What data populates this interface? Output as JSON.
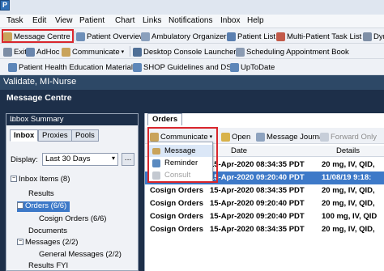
{
  "menubar": {
    "items": [
      "Task",
      "Edit",
      "View",
      "Patient",
      "Chart",
      "Links",
      "Notifications",
      "Inbox",
      "Help"
    ]
  },
  "toolbar1": {
    "items": [
      "Message Centre",
      "Patient Overview",
      "Ambulatory Organizer",
      "Patient List",
      "Multi-Patient Task List",
      "Dyr"
    ]
  },
  "toolbar2": {
    "items": [
      "Exit",
      "AdHoc",
      "Communicate",
      "Desktop Console Launcher",
      "Scheduling Appointment Book"
    ]
  },
  "toolbar3": {
    "items": [
      "Patient Health Education Materials",
      "SHOP Guidelines and DSTs",
      "UpToDate"
    ]
  },
  "validate_bar": {
    "title": "Validate, MI-Nurse"
  },
  "message_centre": {
    "title": "Message Centre"
  },
  "inbox_summary": {
    "title": "Inbox Summary",
    "tabs": [
      "Inbox",
      "Proxies",
      "Pools"
    ],
    "active_tab": "Inbox",
    "display_label": "Display:",
    "display_value": "Last 30 Days",
    "ellipsis": "...",
    "tree": [
      {
        "label": "Inbox Items (8)",
        "toggle": "−"
      },
      {
        "label": "Results",
        "toggle": ""
      },
      {
        "label": "Orders (6/6)",
        "toggle": "−",
        "selected": true
      },
      {
        "label": "Cosign Orders (6/6)",
        "toggle": ""
      },
      {
        "label": "Documents",
        "toggle": ""
      },
      {
        "label": "Messages (2/2)",
        "toggle": "−"
      },
      {
        "label": "General Messages (2/2)",
        "toggle": ""
      },
      {
        "label": "Results FYI",
        "toggle": ""
      }
    ]
  },
  "orders_panel": {
    "tab": "Orders",
    "toolbar": {
      "communicate": "Communicate",
      "open": "Open",
      "message_journal": "Message Journal",
      "forward_only": "Forward Only"
    },
    "columns": [
      "Date",
      "Details"
    ],
    "rows": [
      {
        "type": "",
        "date": "15-Apr-2020 08:34:35 PDT",
        "details": "20 mg, IV, QID,",
        "selected": false
      },
      {
        "type": "",
        "date": "15-Apr-2020 09:20:40 PDT",
        "details": "11/08/19 9:18:",
        "selected": true
      },
      {
        "type": "Cosign Orders",
        "date": "15-Apr-2020 08:34:35 PDT",
        "details": "20 mg, IV, QID,",
        "selected": false
      },
      {
        "type": "Cosign Orders",
        "date": "15-Apr-2020 09:20:40 PDT",
        "details": "20 mg, IV, QID,",
        "selected": false
      },
      {
        "type": "Cosign Orders",
        "date": "15-Apr-2020 09:20:40 PDT",
        "details": "100 mg, IV, QID",
        "selected": false
      },
      {
        "type": "Cosign Orders",
        "date": "15-Apr-2020 08:34:35 PDT",
        "details": "20 mg, IV, QID,",
        "selected": false
      }
    ]
  },
  "communicate_menu": {
    "items": [
      {
        "label": "Message",
        "enabled": true
      },
      {
        "label": "Reminder",
        "enabled": true
      },
      {
        "label": "Consult",
        "enabled": false
      }
    ]
  },
  "colors": {
    "dark_header": "#1d2f49",
    "validate_bar": "#2d4866",
    "selection": "#3d79c8",
    "highlight_box": "#d9262c"
  }
}
